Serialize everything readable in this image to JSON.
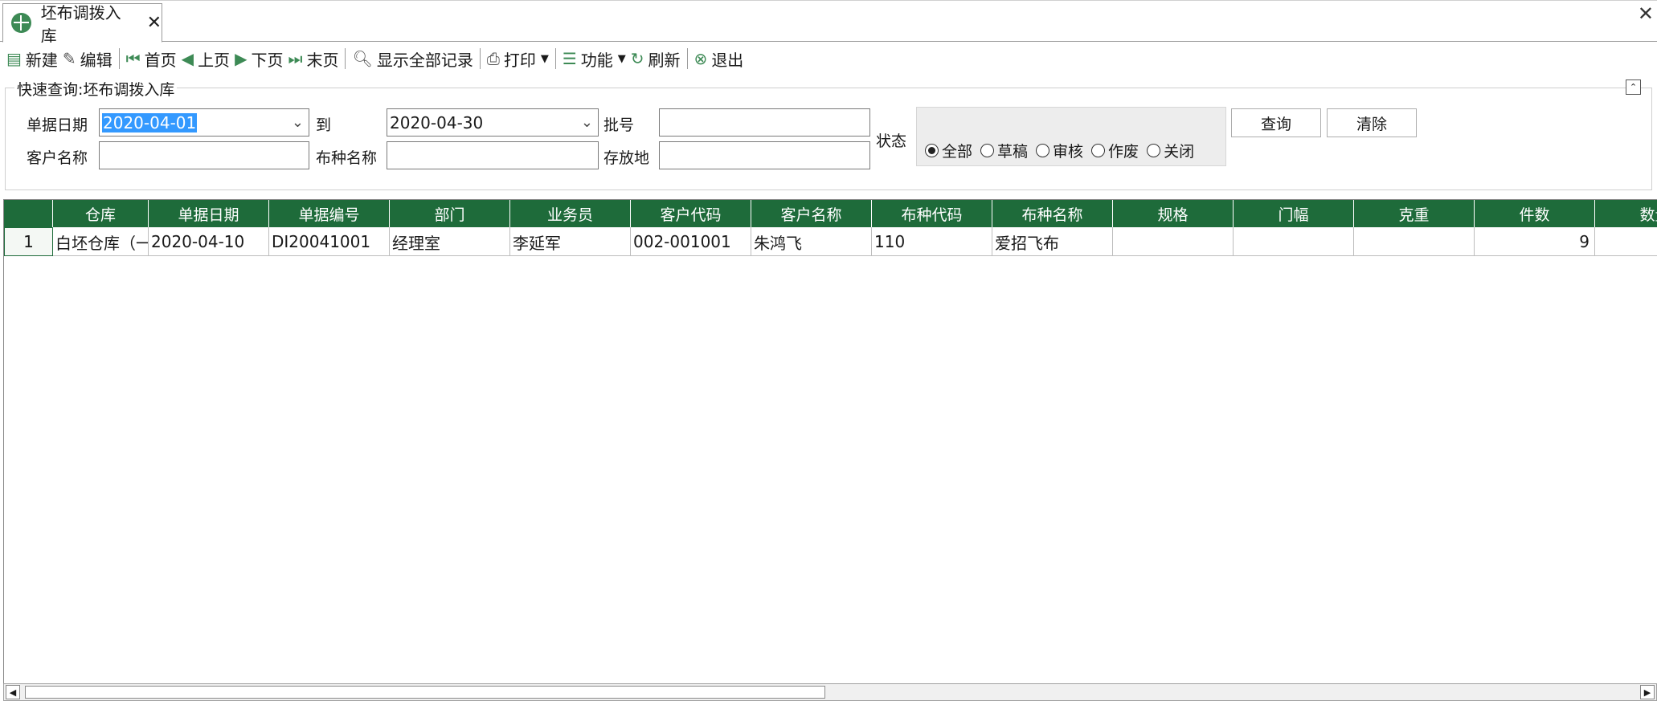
{
  "tab": {
    "title": "坯布调拨入库",
    "close": "✕"
  },
  "window_close": "✕",
  "toolbar": {
    "new": "新建",
    "edit": "编辑",
    "first": "首页",
    "prev": "上页",
    "next": "下页",
    "last": "末页",
    "show_all": "显示全部记录",
    "print": "打印",
    "function": "功能",
    "refresh": "刷新",
    "exit": "退出"
  },
  "query": {
    "title": "快速查询:坯布调拨入库",
    "date_label": "单据日期",
    "date_from": "2020-04-01",
    "to_label": "到",
    "date_to": "2020-04-30",
    "batch_label": "批号",
    "batch_value": "",
    "status_label": "状态",
    "customer_label": "客户名称",
    "customer_value": "",
    "fabric_label": "布种名称",
    "fabric_value": "",
    "storage_label": "存放地",
    "storage_value": "",
    "status_options": [
      "全部",
      "草稿",
      "审核",
      "作废",
      "关闭"
    ],
    "status_selected": "全部",
    "query_button": "查询",
    "clear_button": "清除"
  },
  "grid": {
    "columns": [
      "仓库",
      "单据日期",
      "单据编号",
      "部门",
      "业务员",
      "客户代码",
      "客户名称",
      "布种代码",
      "布种名称",
      "规格",
      "门幅",
      "克重",
      "件数",
      "数量"
    ],
    "rows": [
      {
        "row_number": "1",
        "cells": [
          "白坯仓库（一",
          "2020-04-10",
          "DI20041001",
          "经理室",
          "李延军",
          "002-001001",
          "朱鸿飞",
          "110",
          "爱招飞布",
          "",
          "",
          "",
          "9",
          ""
        ]
      }
    ]
  }
}
